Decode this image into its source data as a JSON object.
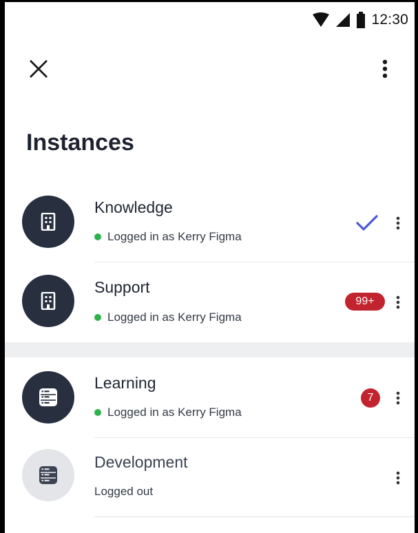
{
  "status_bar": {
    "time": "12:30"
  },
  "header": {
    "title": "Instances"
  },
  "instances": [
    {
      "name": "Knowledge",
      "status": "Logged in as Kerry Figma",
      "logged_in": true,
      "selected": true,
      "badge": ""
    },
    {
      "name": "Support",
      "status": "Logged in as Kerry Figma",
      "logged_in": true,
      "selected": false,
      "badge": "99+"
    },
    {
      "name": "Learning",
      "status": "Logged in as Kerry Figma",
      "logged_in": true,
      "selected": false,
      "badge": "7"
    },
    {
      "name": "Development",
      "status": "Logged out",
      "logged_in": false,
      "selected": false,
      "badge": ""
    }
  ],
  "colors": {
    "accent_check": "#4a56d6",
    "badge": "#c1232f",
    "online_dot": "#2db24a",
    "avatar_dark": "#283040"
  },
  "icons": {
    "close": "close-icon",
    "more": "more-vert-icon",
    "building": "building-icon",
    "server": "server-icon",
    "check": "check-icon"
  }
}
